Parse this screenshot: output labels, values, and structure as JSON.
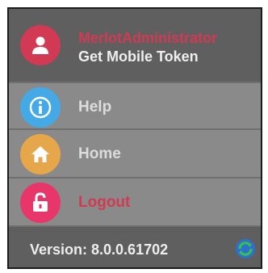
{
  "colors": {
    "panel_bg": "#5f5f5f",
    "menu_bg": "#8a8a8a",
    "accent_red": "#d13a52",
    "help_blue": "#45a9e6",
    "home_orange": "#e6a64a",
    "logout_pink": "#e8356a"
  },
  "header": {
    "user_name": "MerlotAdministrator",
    "token_link": "Get Mobile Token",
    "avatar_icon": "user-icon"
  },
  "menu": {
    "items": [
      {
        "label": "Help",
        "icon": "info-icon"
      },
      {
        "label": "Home",
        "icon": "home-icon"
      },
      {
        "label": "Logout",
        "icon": "unlock-icon"
      }
    ]
  },
  "footer": {
    "version": "Version: 8.0.0.61702",
    "refresh_icon": "refresh-icon"
  }
}
